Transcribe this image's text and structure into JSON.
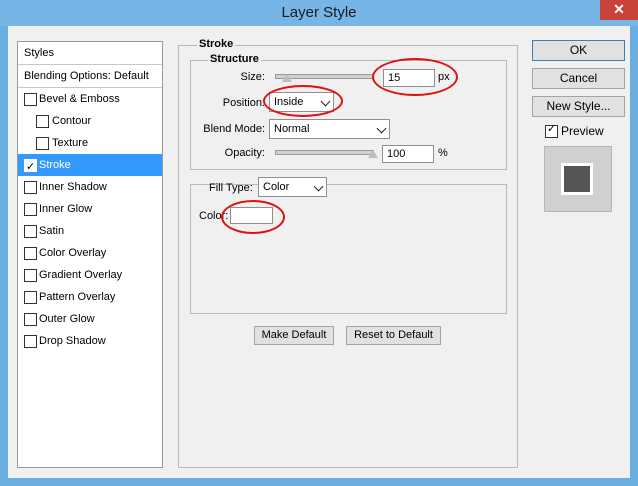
{
  "window": {
    "title": "Layer Style",
    "close_symbol": "✕"
  },
  "sidebar": {
    "header": "Styles",
    "blending_options": "Blending Options: Default",
    "items": [
      {
        "label": "Bevel & Emboss",
        "checked": false
      },
      {
        "label": "Contour",
        "checked": false
      },
      {
        "label": "Texture",
        "checked": false
      },
      {
        "label": "Stroke",
        "checked": true,
        "selected": true
      },
      {
        "label": "Inner Shadow",
        "checked": false
      },
      {
        "label": "Inner Glow",
        "checked": false
      },
      {
        "label": "Satin",
        "checked": false
      },
      {
        "label": "Color Overlay",
        "checked": false
      },
      {
        "label": "Gradient Overlay",
        "checked": false
      },
      {
        "label": "Pattern Overlay",
        "checked": false
      },
      {
        "label": "Outer Glow",
        "checked": false
      },
      {
        "label": "Drop Shadow",
        "checked": false
      }
    ]
  },
  "stroke": {
    "section_title": "Stroke",
    "structure_title": "Structure",
    "size_label": "Size:",
    "size_value": "15",
    "size_unit": "px",
    "position_label": "Position:",
    "position_value": "Inside",
    "blend_mode_label": "Blend Mode:",
    "blend_mode_value": "Normal",
    "opacity_label": "Opacity:",
    "opacity_value": "100",
    "opacity_unit": "%",
    "fill_type_label": "Fill Type:",
    "fill_type_value": "Color",
    "color_label": "Color:",
    "color_value": "#ffffff",
    "make_default": "Make Default",
    "reset_default": "Reset to Default"
  },
  "actions": {
    "ok": "OK",
    "cancel": "Cancel",
    "new_style": "New Style...",
    "preview_label": "Preview",
    "preview_checked": true
  },
  "annotations": {
    "color": "#e01010"
  }
}
